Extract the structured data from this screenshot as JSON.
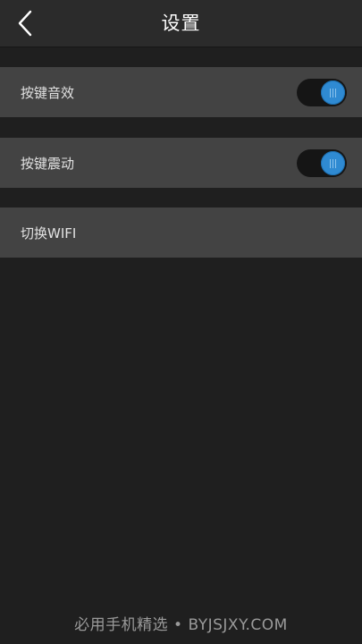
{
  "header": {
    "title": "设置"
  },
  "settings": {
    "sound": {
      "label": "按键音效",
      "enabled": true
    },
    "vibrate": {
      "label": "按键震动",
      "enabled": true
    },
    "wifi": {
      "label": "切换WIFI"
    }
  },
  "watermark": "必用手机精选 • BYJSJXY.COM",
  "colors": {
    "accent": "#2f8ad2",
    "row": "#434343",
    "background": "#1f1f1f",
    "topbar": "#2b2b2b"
  },
  "icons": {
    "back": "back-chevron-icon"
  }
}
